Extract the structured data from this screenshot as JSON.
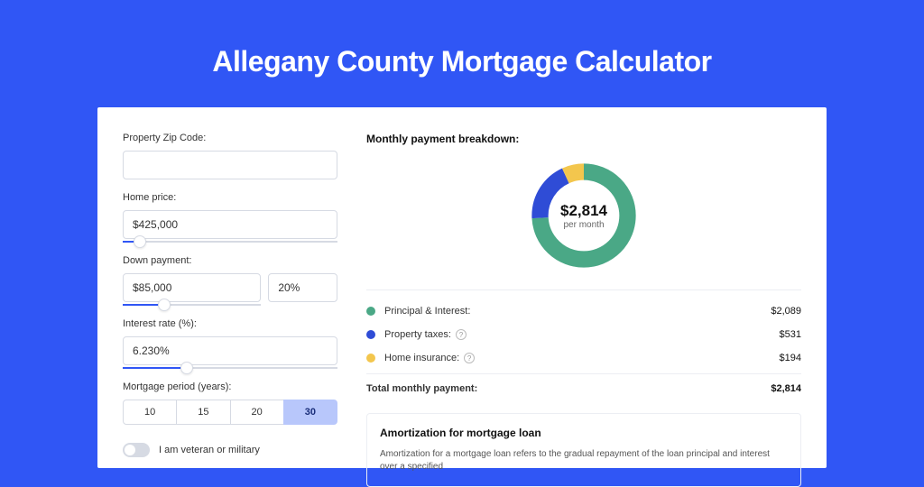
{
  "title": "Allegany County Mortgage Calculator",
  "form": {
    "zip": {
      "label": "Property Zip Code:",
      "value": ""
    },
    "home_price": {
      "label": "Home price:",
      "value": "$425,000",
      "slider_pct": 8
    },
    "down_payment": {
      "label": "Down payment:",
      "value": "$85,000",
      "pct": "20%",
      "slider_pct": 20
    },
    "interest": {
      "label": "Interest rate (%):",
      "value": "6.230%",
      "slider_pct": 30
    },
    "period": {
      "label": "Mortgage period (years):",
      "options": [
        "10",
        "15",
        "20",
        "30"
      ],
      "selected": "30"
    },
    "veteran": {
      "label": "I am veteran or military",
      "on": false
    }
  },
  "breakdown": {
    "title": "Monthly payment breakdown:",
    "center_amount": "$2,814",
    "center_sub": "per month",
    "segments": [
      {
        "name": "Principal & Interest:",
        "value": "$2,089",
        "color": "#4aa886",
        "pct": 74
      },
      {
        "name": "Property taxes:",
        "value": "$531",
        "color": "#2f4cd6",
        "pct": 19,
        "help": true
      },
      {
        "name": "Home insurance:",
        "value": "$194",
        "color": "#f3c64d",
        "pct": 7,
        "help": true
      }
    ],
    "total": {
      "label": "Total monthly payment:",
      "value": "$2,814"
    }
  },
  "amortization": {
    "title": "Amortization for mortgage loan",
    "text": "Amortization for a mortgage loan refers to the gradual repayment of the loan principal and interest over a specified"
  }
}
